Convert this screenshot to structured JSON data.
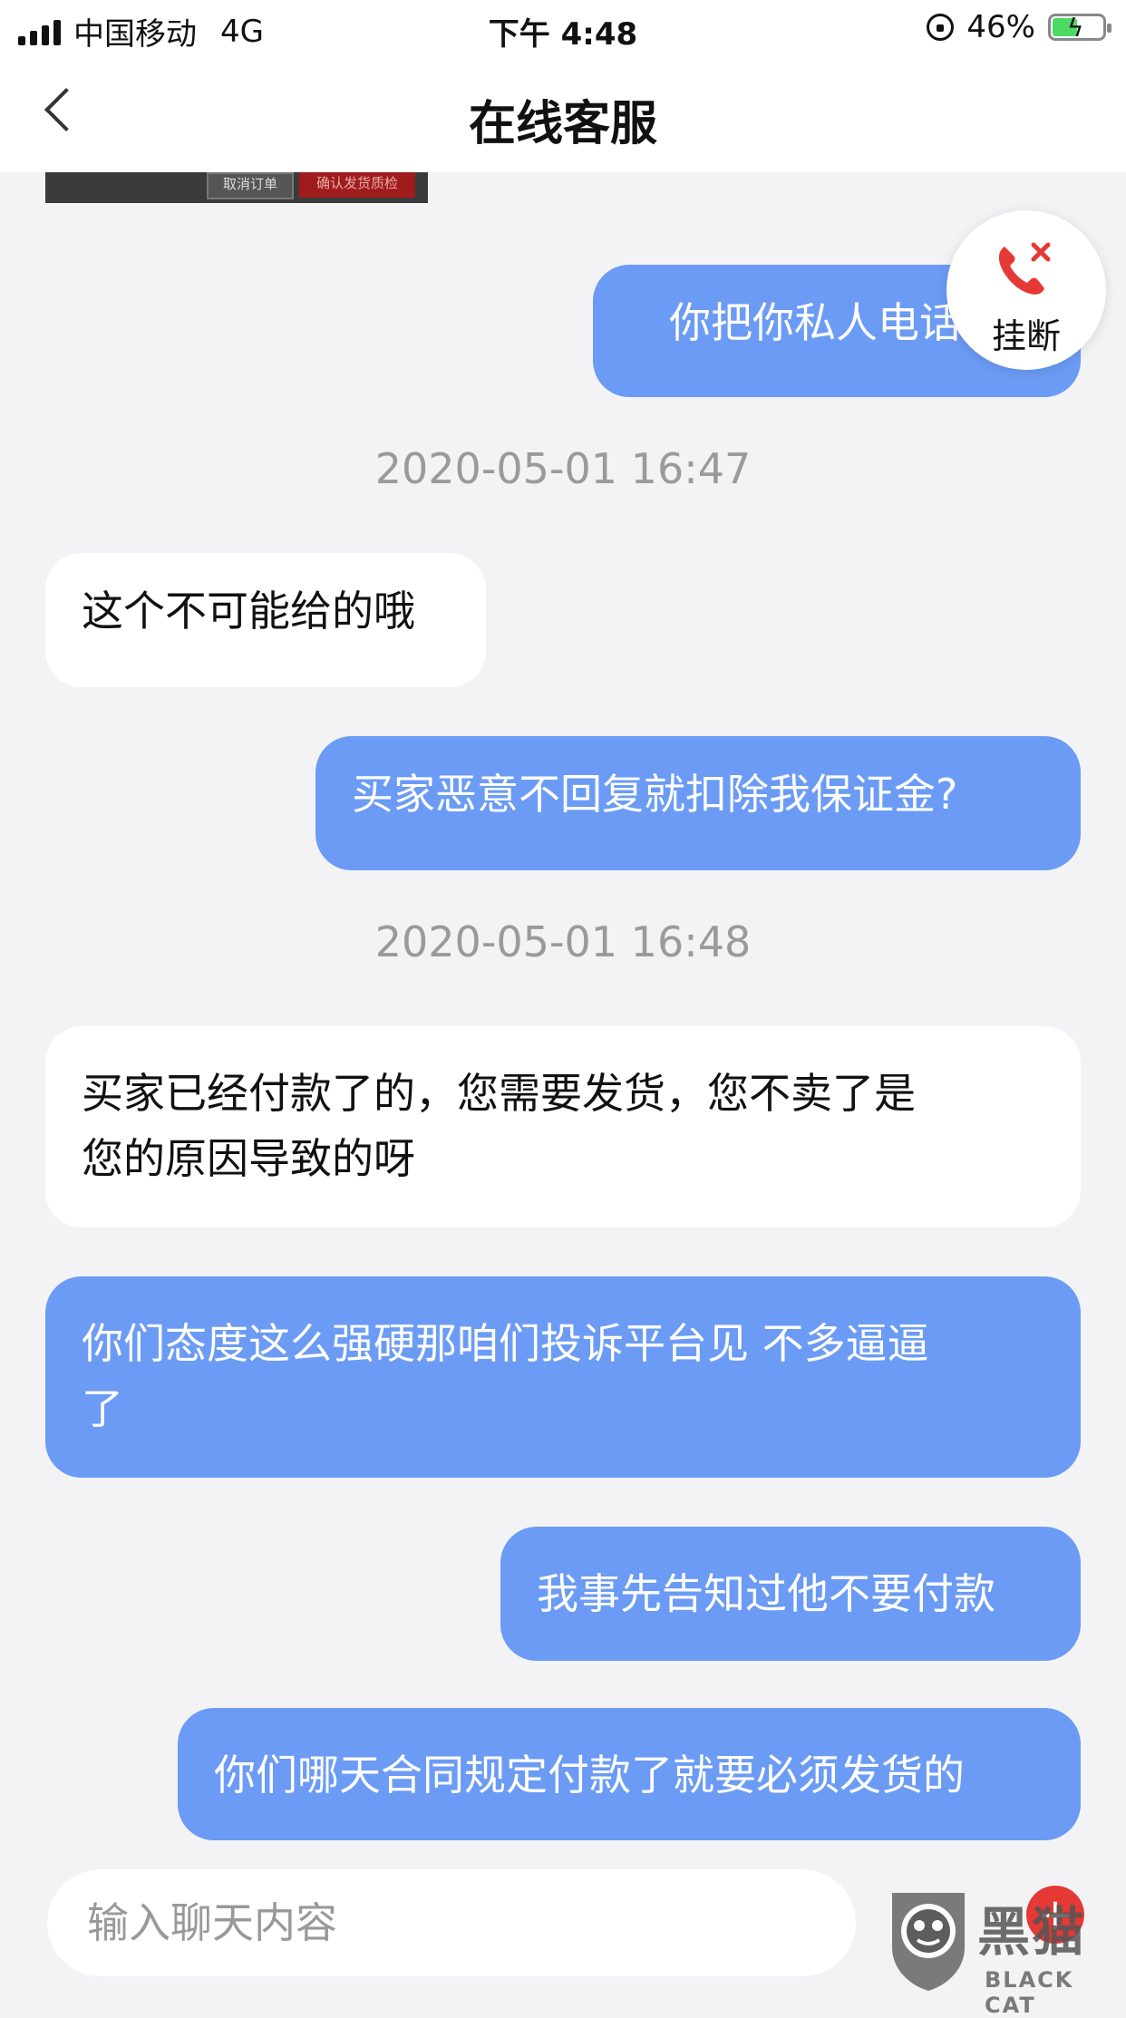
{
  "status_bar": {
    "carrier": "中国移动",
    "network": "4G",
    "time": "下午 4:48",
    "battery": "46%",
    "battery_level": 0.46
  },
  "nav": {
    "title": "在线客服",
    "back_icon": "chevron-left-icon"
  },
  "previous_card": {
    "cancel_label": "取消订单",
    "confirm_label": "确认发货质检"
  },
  "messages": [
    {
      "side": "out",
      "text": "你把你私人电话给我"
    },
    {
      "type": "timestamp",
      "text": "2020-05-01 16:47"
    },
    {
      "side": "in",
      "text": "这个不可能给的哦"
    },
    {
      "side": "out",
      "text": "买家恶意不回复就扣除我保证金?"
    },
    {
      "type": "timestamp",
      "text": "2020-05-01 16:48"
    },
    {
      "side": "in",
      "line1": "买家已经付款了的，您需要发货，您不卖了是",
      "line2": "您的原因导致的呀"
    },
    {
      "side": "out",
      "line1": "你们态度这么强硬那咱们投诉平台见 不多逼逼",
      "line2": "了"
    },
    {
      "side": "out",
      "text": "我事先告知过他不要付款"
    },
    {
      "side": "out",
      "text": "你们哪天合同规定付款了就要必须发货的"
    }
  ],
  "hangup": {
    "label": "挂断",
    "icon": "phone-hangup-icon",
    "icon_color": "#e53935"
  },
  "composer": {
    "placeholder": "输入聊天内容",
    "plus_icon": "plus-icon"
  },
  "watermark": {
    "cn": "黑猫",
    "en": "BLACK CAT"
  },
  "colors": {
    "outgoing_bubble": "#6b9bf4",
    "incoming_bubble": "#ffffff",
    "background": "#f3f3f5"
  }
}
